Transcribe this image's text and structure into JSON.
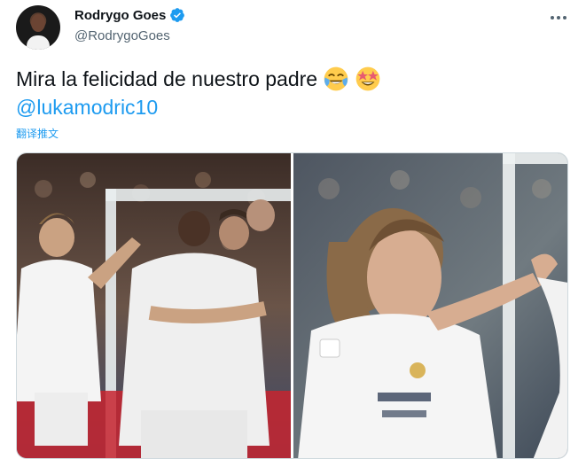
{
  "author": {
    "display_name": "Rodrygo Goes",
    "handle": "@RodrygoGoes",
    "verified": true,
    "avatar_icon": "profile-avatar"
  },
  "tweet": {
    "text": "Mira la felicidad de nuestro padre",
    "emojis": [
      "face-with-tears-of-joy",
      "star-struck"
    ],
    "mention": "@lukamodric10",
    "translate_label": "翻译推文"
  },
  "media": {
    "count": 2,
    "photos": [
      "celebration-group-photo",
      "modric-celebration-photo"
    ]
  },
  "colors": {
    "link": "#1d9bf0",
    "text": "#0f1419",
    "secondary": "#536471",
    "verified": "#1d9bf0"
  }
}
